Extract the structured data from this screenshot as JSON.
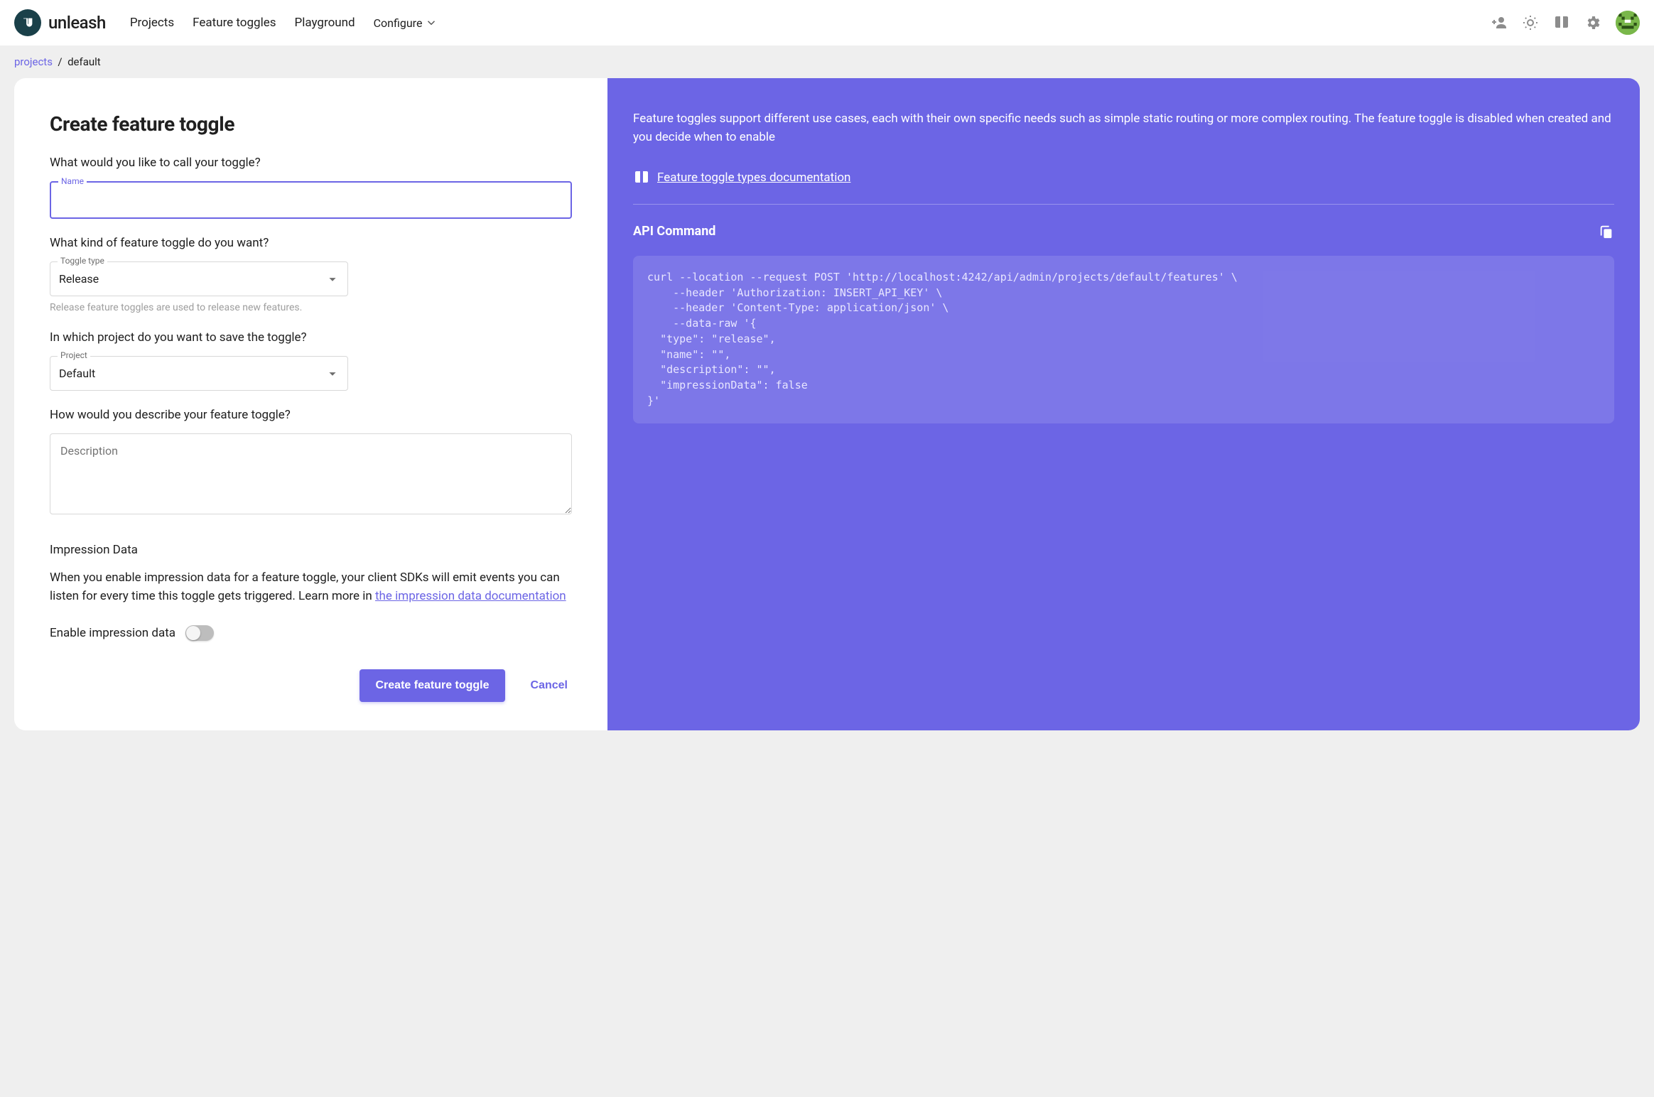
{
  "brand": "unleash",
  "nav": {
    "projects": "Projects",
    "toggles": "Feature toggles",
    "playground": "Playground",
    "configure": "Configure"
  },
  "breadcrumb": {
    "root": "projects",
    "sep": "/",
    "current": "default"
  },
  "form": {
    "title": "Create feature toggle",
    "name_q": "What would you like to call your toggle?",
    "name_label": "Name",
    "name_value": "",
    "type_q": "What kind of feature toggle do you want?",
    "type_label": "Toggle type",
    "type_value": "Release",
    "type_helper": "Release feature toggles are used to release new features.",
    "project_q": "In which project do you want to save the toggle?",
    "project_label": "Project",
    "project_value": "Default",
    "desc_q": "How would you describe your feature toggle?",
    "desc_placeholder": "Description",
    "impression_title": "Impression Data",
    "impression_body": "When you enable impression data for a feature toggle, your client SDKs will emit events you can listen for every time this toggle gets triggered. Learn more in ",
    "impression_link": "the impression data documentation",
    "enable_switch": "Enable impression data",
    "submit": "Create feature toggle",
    "cancel": "Cancel"
  },
  "side": {
    "intro": "Feature toggles support different use cases, each with their own specific needs such as simple static routing or more complex routing. The feature toggle is disabled when created and you decide when to enable",
    "doc_link": "Feature toggle types documentation",
    "api_title": "API Command",
    "code": "curl --location --request POST 'http://localhost:4242/api/admin/projects/default/features' \\\n    --header 'Authorization: INSERT_API_KEY' \\\n    --header 'Content-Type: application/json' \\\n    --data-raw '{\n  \"type\": \"release\",\n  \"name\": \"\",\n  \"description\": \"\",\n  \"impressionData\": false\n}'"
  }
}
